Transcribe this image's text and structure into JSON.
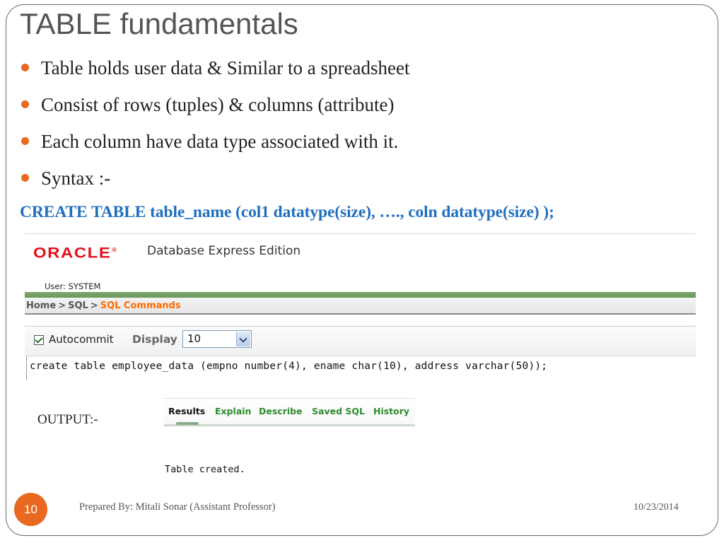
{
  "slide": {
    "title": "TABLE fundamentals",
    "bullets": [
      "Table holds user data & Similar to a spreadsheet",
      "Consist of rows (tuples) & columns (attribute)",
      "Each column have data type associated with it.",
      "Syntax :-"
    ],
    "syntax": "CREATE TABLE table_name (col1 datatype(size), …., coln  datatype(size) );",
    "output_label": "OUTPUT:-",
    "page_number": "10",
    "footer": "Prepared By: Mitali Sonar (Assistant Professor)",
    "date": "10/23/2014"
  },
  "app": {
    "logo_text": "ORACLE",
    "logo_tm": "®",
    "edition": "Database Express Edition",
    "user": "User: SYSTEM",
    "breadcrumb": [
      "Home",
      "SQL",
      "SQL Commands"
    ],
    "breadcrumb_sep": ">",
    "autocommit_label": "Autocommit",
    "autocommit_checked": true,
    "display_label": "Display",
    "display_value": "10",
    "sql_text": "create table employee_data (empno number(4), ename char(10), address varchar(50));",
    "tabs": [
      "Results",
      "Explain",
      "Describe",
      "Saved SQL",
      "History"
    ],
    "active_tab": "Results",
    "result_text": "Table created."
  },
  "colors": {
    "accent": "#e8691f",
    "syntax": "#1f6fbf",
    "oracle_red": "#e0121c",
    "breadcrumb_current": "#ff6a00",
    "tab_green": "#2e8b2e"
  }
}
